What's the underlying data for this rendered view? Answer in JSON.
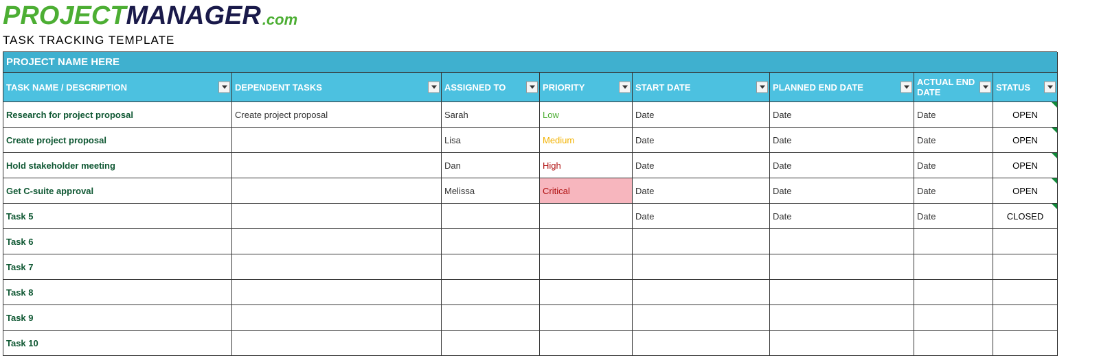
{
  "logo": {
    "part1": "PROJECT",
    "part2": "MANAGER",
    "part3": ".com"
  },
  "subtitle": "TASK TRACKING TEMPLATE",
  "project_name": "PROJECT NAME HERE",
  "columns": [
    "TASK NAME / DESCRIPTION",
    "DEPENDENT TASKS",
    "ASSIGNED TO",
    "PRIORITY",
    "START DATE",
    "PLANNED END DATE",
    "ACTUAL END DATE",
    "STATUS"
  ],
  "rows": [
    {
      "task": "Research for project proposal",
      "dependent": "Create project proposal",
      "assigned": "Sarah",
      "priority": "Low",
      "start": "Date",
      "planned": "Date",
      "actual": "Date",
      "status": "OPEN",
      "tick": true
    },
    {
      "task": "Create project proposal",
      "dependent": "",
      "assigned": "Lisa",
      "priority": "Medium",
      "start": "Date",
      "planned": "Date",
      "actual": "Date",
      "status": "OPEN",
      "tick": true
    },
    {
      "task": "Hold stakeholder meeting",
      "dependent": "",
      "assigned": "Dan",
      "priority": "High",
      "start": "Date",
      "planned": "Date",
      "actual": "Date",
      "status": "OPEN",
      "tick": true
    },
    {
      "task": "Get C-suite approval",
      "dependent": "",
      "assigned": "Melissa",
      "priority": "Critical",
      "start": "Date",
      "planned": "Date",
      "actual": "Date",
      "status": "OPEN",
      "tick": true
    },
    {
      "task": "Task 5",
      "dependent": "",
      "assigned": "",
      "priority": "",
      "start": "Date",
      "planned": "Date",
      "actual": "Date",
      "status": "CLOSED",
      "tick": true
    },
    {
      "task": "Task 6",
      "dependent": "",
      "assigned": "",
      "priority": "",
      "start": "",
      "planned": "",
      "actual": "",
      "status": "",
      "tick": false
    },
    {
      "task": "Task 7",
      "dependent": "",
      "assigned": "",
      "priority": "",
      "start": "",
      "planned": "",
      "actual": "",
      "status": "",
      "tick": false
    },
    {
      "task": "Task 8",
      "dependent": "",
      "assigned": "",
      "priority": "",
      "start": "",
      "planned": "",
      "actual": "",
      "status": "",
      "tick": false
    },
    {
      "task": "Task 9",
      "dependent": "",
      "assigned": "",
      "priority": "",
      "start": "",
      "planned": "",
      "actual": "",
      "status": "",
      "tick": false
    },
    {
      "task": "Task 10",
      "dependent": "",
      "assigned": "",
      "priority": "",
      "start": "",
      "planned": "",
      "actual": "",
      "status": "",
      "tick": false
    }
  ]
}
